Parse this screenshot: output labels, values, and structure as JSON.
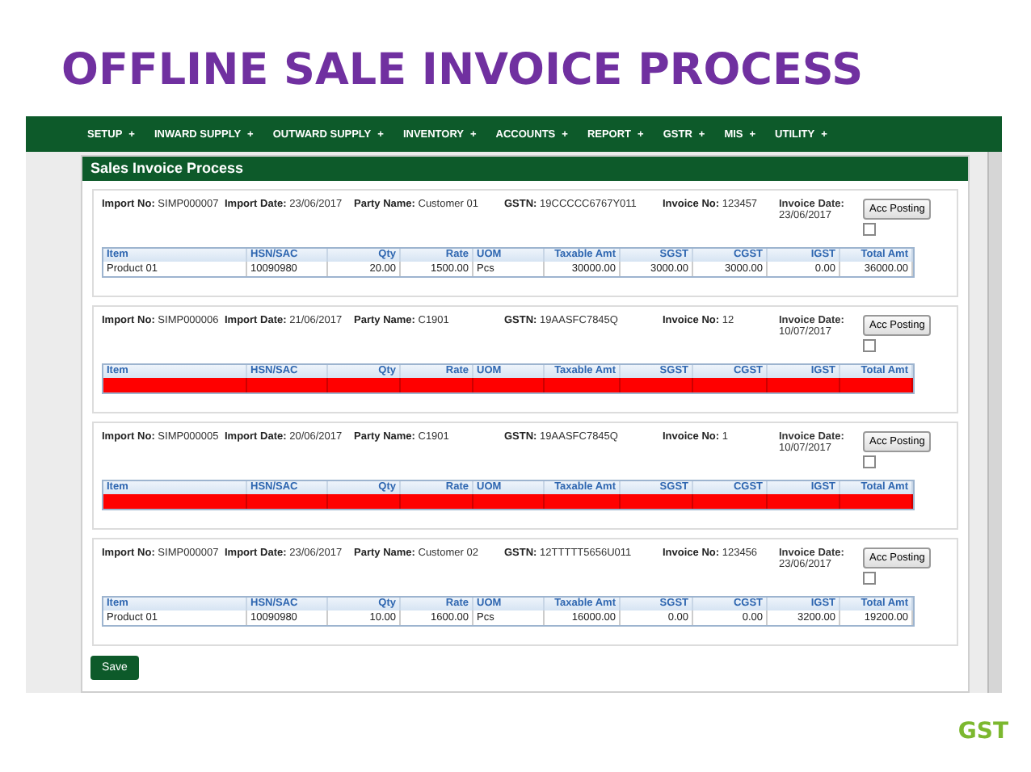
{
  "slide_title": "OFFLINE SALE INVOICE PROCESS",
  "nav": [
    {
      "label": "SETUP",
      "marker": "+"
    },
    {
      "label": "INWARD SUPPLY",
      "marker": "+"
    },
    {
      "label": "OUTWARD SUPPLY",
      "marker": "+"
    },
    {
      "label": "INVENTORY",
      "marker": "+"
    },
    {
      "label": "ACCOUNTS",
      "marker": "+"
    },
    {
      "label": "REPORT",
      "marker": "+"
    },
    {
      "label": "GSTR",
      "marker": "+"
    },
    {
      "label": "MIS",
      "marker": "+"
    },
    {
      "label": "UTILITY",
      "marker": "+"
    }
  ],
  "panel": {
    "title": "Sales Invoice Process",
    "invoices": [
      {
        "fields": [
          {
            "label": "Import No:",
            "value": "SIMP000007"
          },
          {
            "label": "Import Date:",
            "value": "23/06/2017"
          },
          {
            "label": "Party Name:",
            "value": "Customer 01"
          },
          {
            "label": "GSTN:",
            "value": "19CCCCC6767Y011"
          },
          {
            "label": "Invoice No:",
            "value": "123457"
          },
          {
            "label": "Invoice Date:",
            "value": "23/06/2017"
          }
        ],
        "button": "Acc Posting",
        "checked": false,
        "columns": [
          "Item",
          "HSN/SAC",
          "Qty",
          "Rate",
          "UOM",
          "Taxable Amt",
          "SGST",
          "CGST",
          "IGST",
          "Total Amt"
        ],
        "rows": [
          {
            "error": false,
            "cells": [
              "Product 01",
              "10090980",
              "20.00",
              "1500.00",
              "Pcs",
              "30000.00",
              "3000.00",
              "3000.00",
              "0.00",
              "36000.00"
            ]
          }
        ]
      },
      {
        "fields": [
          {
            "label": "Import No:",
            "value": "SIMP000006"
          },
          {
            "label": "Import Date:",
            "value": "21/06/2017"
          },
          {
            "label": "Party Name:",
            "value": "C1901"
          },
          {
            "label": "GSTN:",
            "value": "19AASFC7845Q"
          },
          {
            "label": "Invoice No:",
            "value": "12"
          },
          {
            "label": "Invoice Date:",
            "value": "10/07/2017"
          }
        ],
        "button": "Acc Posting",
        "checked": false,
        "columns": [
          "Item",
          "HSN/SAC",
          "Qty",
          "Rate",
          "UOM",
          "Taxable Amt",
          "SGST",
          "CGST",
          "IGST",
          "Total Amt"
        ],
        "rows": [
          {
            "error": true
          }
        ]
      },
      {
        "fields": [
          {
            "label": "Import No:",
            "value": "SIMP000005"
          },
          {
            "label": "Import Date:",
            "value": "20/06/2017"
          },
          {
            "label": "Party Name:",
            "value": "C1901"
          },
          {
            "label": "GSTN:",
            "value": "19AASFC7845Q"
          },
          {
            "label": "Invoice No:",
            "value": "1"
          },
          {
            "label": "Invoice Date:",
            "value": "10/07/2017"
          }
        ],
        "button": "Acc Posting",
        "checked": false,
        "columns": [
          "Item",
          "HSN/SAC",
          "Qty",
          "Rate",
          "UOM",
          "Taxable Amt",
          "SGST",
          "CGST",
          "IGST",
          "Total Amt"
        ],
        "rows": [
          {
            "error": true
          }
        ]
      },
      {
        "fields": [
          {
            "label": "Import No:",
            "value": "SIMP000007"
          },
          {
            "label": "Import Date:",
            "value": "23/06/2017"
          },
          {
            "label": "Party Name:",
            "value": "Customer 02"
          },
          {
            "label": "GSTN:",
            "value": "12TTTTT5656U011"
          },
          {
            "label": "Invoice No:",
            "value": "123456"
          },
          {
            "label": "Invoice Date:",
            "value": "23/06/2017"
          }
        ],
        "button": "Acc Posting",
        "checked": false,
        "columns": [
          "Item",
          "HSN/SAC",
          "Qty",
          "Rate",
          "UOM",
          "Taxable Amt",
          "SGST",
          "CGST",
          "IGST",
          "Total Amt"
        ],
        "rows": [
          {
            "error": false,
            "cells": [
              "Product 01",
              "10090980",
              "10.00",
              "1600.00",
              "Pcs",
              "16000.00",
              "0.00",
              "0.00",
              "3200.00",
              "19200.00"
            ]
          }
        ]
      }
    ],
    "save_button": "Save"
  },
  "logo": "GST"
}
